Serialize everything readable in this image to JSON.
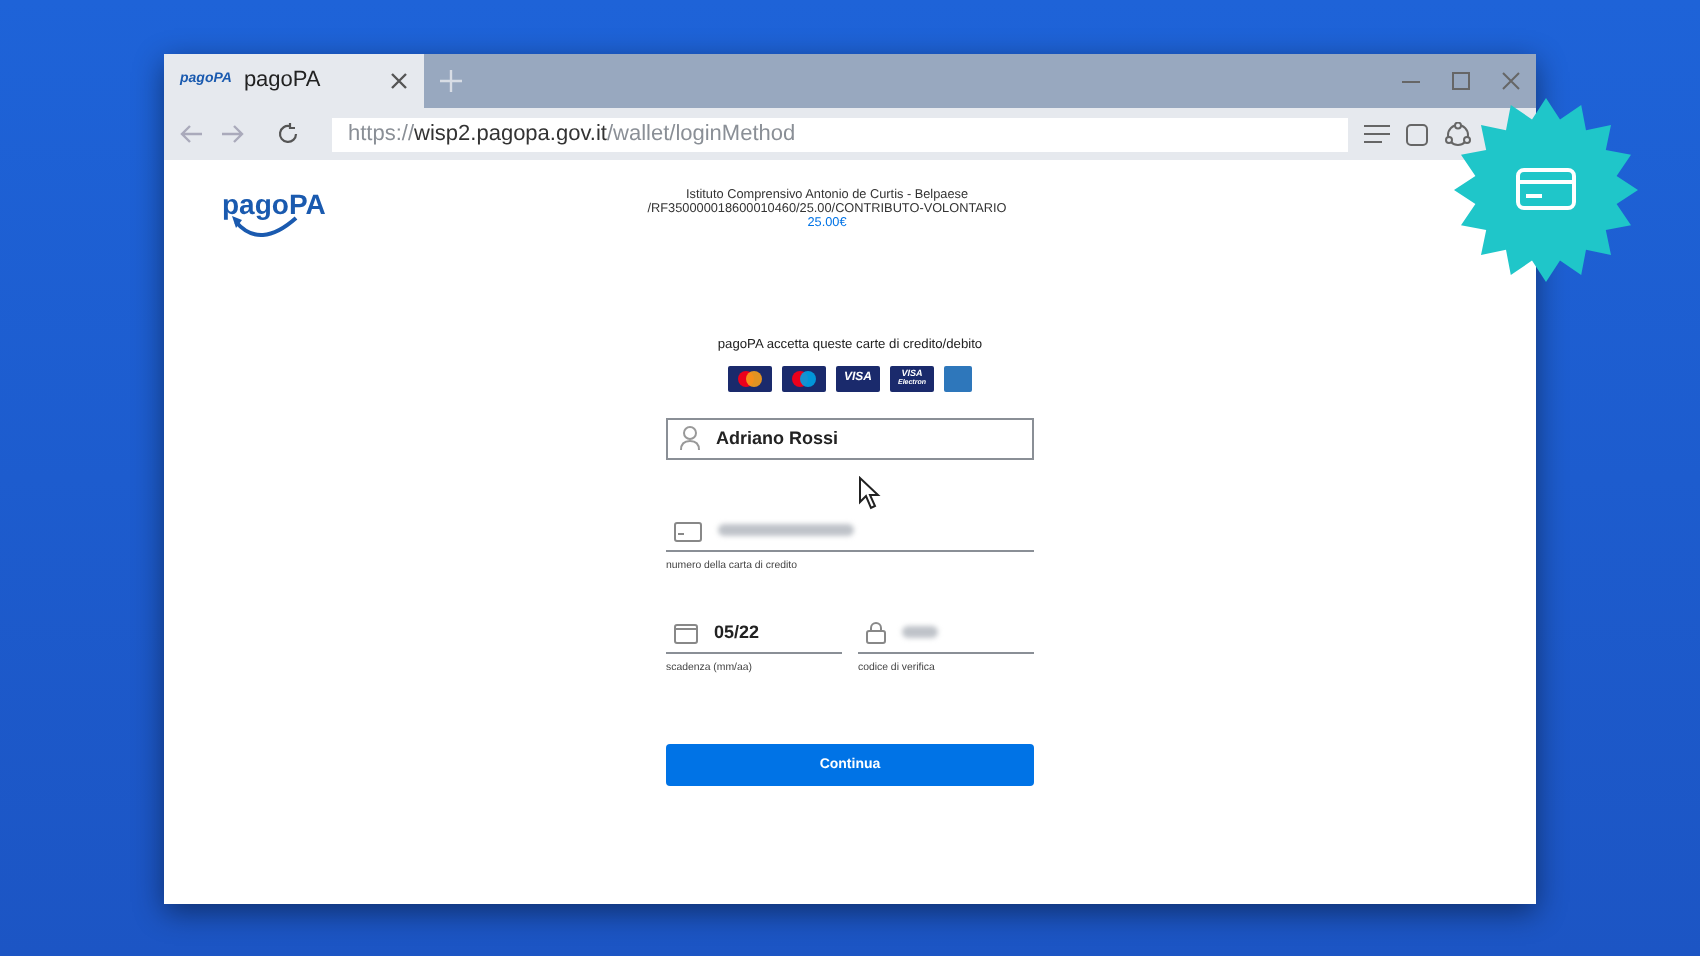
{
  "browser": {
    "tab": {
      "favicon_text": "pagoPA",
      "title": "pagoPA"
    },
    "address": {
      "scheme": "https://",
      "host": "wisp2.pagopa.gov.it",
      "path": "/wallet/loginMethod"
    }
  },
  "page": {
    "logo": "pagoPA",
    "payee": [
      "Istituto Comprensivo Antonio de Curtis - Belpaese",
      "/RF350000018600010460/25.00/CONTRIBUTO-VOLONTARIO"
    ],
    "amount": "25.00€",
    "accepted_text": "pagoPA accetta queste carte di credito/debito",
    "cards": [
      {
        "kind": "mastercard"
      },
      {
        "kind": "maestro"
      },
      {
        "kind": "visa",
        "label": "VISA"
      },
      {
        "kind": "visa-electron",
        "label": "VISA",
        "sublabel": "Electron"
      },
      {
        "kind": "amex"
      }
    ],
    "name_field": {
      "value": "Adriano Rossi"
    },
    "card_number": {
      "masked": true,
      "label": "numero della carta di credito"
    },
    "expiry": {
      "value": "05/22",
      "label": "scadenza (mm/aa)"
    },
    "cvv": {
      "masked": true,
      "label": "codice di verifica"
    },
    "button": "Continua"
  }
}
